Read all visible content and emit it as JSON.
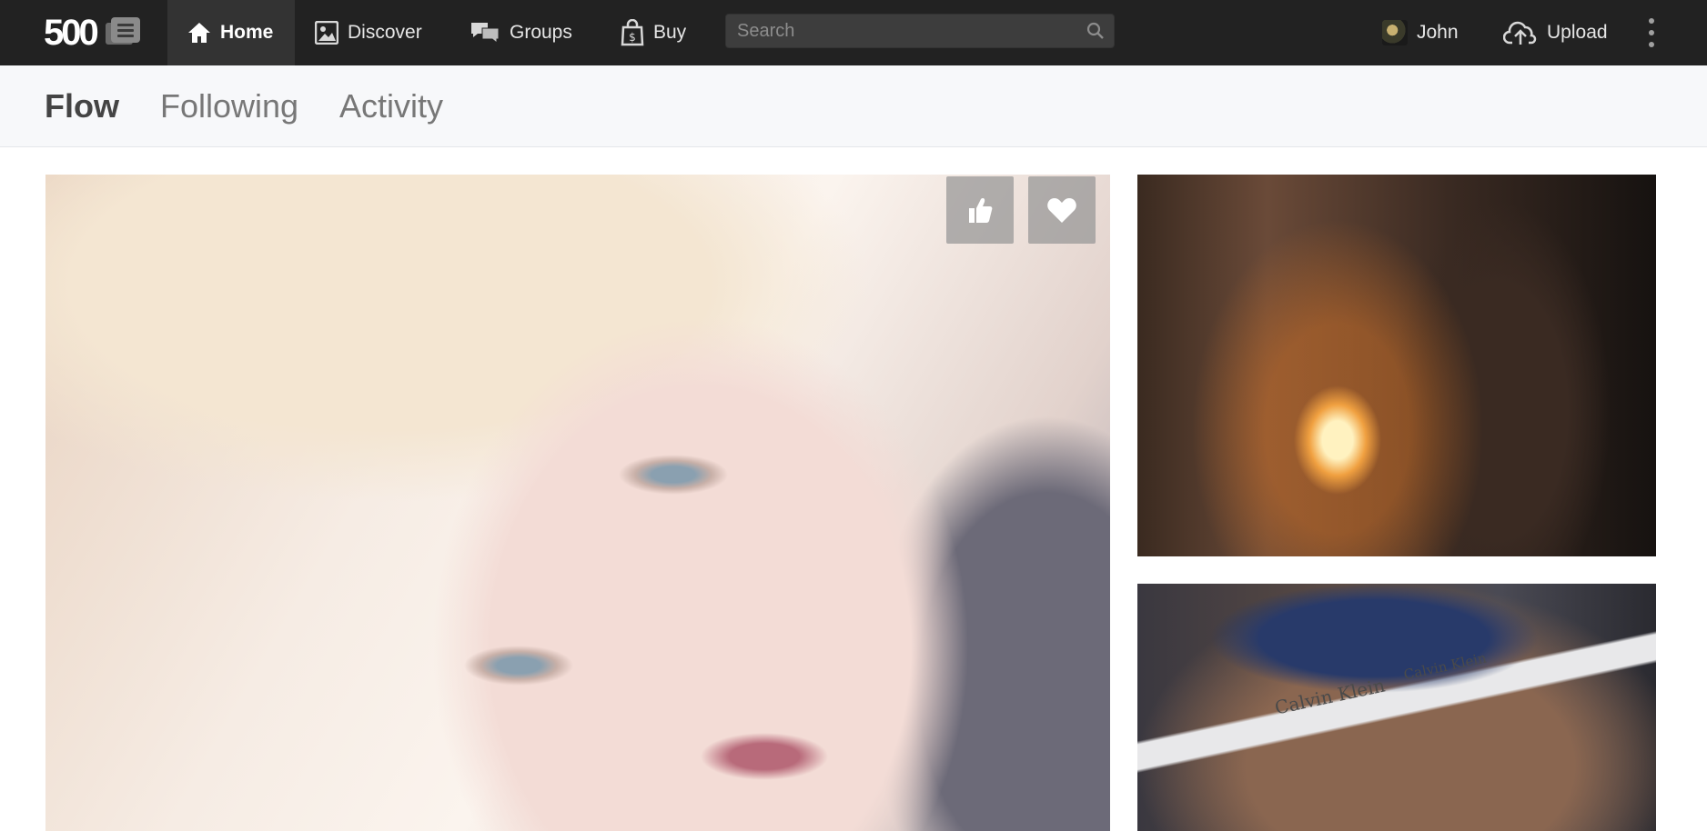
{
  "app": {
    "logo_text": "500",
    "logo_menu_icon": "stacked-menu-icon"
  },
  "nav": {
    "items": [
      {
        "label": "Home",
        "icon": "house-icon",
        "active": true
      },
      {
        "label": "Discover",
        "icon": "picture-icon",
        "active": false
      },
      {
        "label": "Groups",
        "icon": "chat-bubbles-icon",
        "active": false
      },
      {
        "label": "Buy",
        "icon": "shopping-bag-icon",
        "active": false
      }
    ]
  },
  "search": {
    "placeholder": "Search",
    "value": ""
  },
  "user": {
    "name": "John"
  },
  "upload": {
    "label": "Upload",
    "icon": "cloud-upload-icon"
  },
  "subnav": {
    "tabs": [
      {
        "label": "Flow",
        "active": true
      },
      {
        "label": "Following",
        "active": false
      },
      {
        "label": "Activity",
        "active": false
      }
    ]
  },
  "photos": {
    "band_text": "Calvin Klein"
  },
  "actions": {
    "like_icon": "thumbs-up-icon",
    "favorite_icon": "heart-icon"
  },
  "colors": {
    "topbar": "#222222",
    "active_nav": "#333333",
    "subnav_bg": "#f7f8fa"
  }
}
